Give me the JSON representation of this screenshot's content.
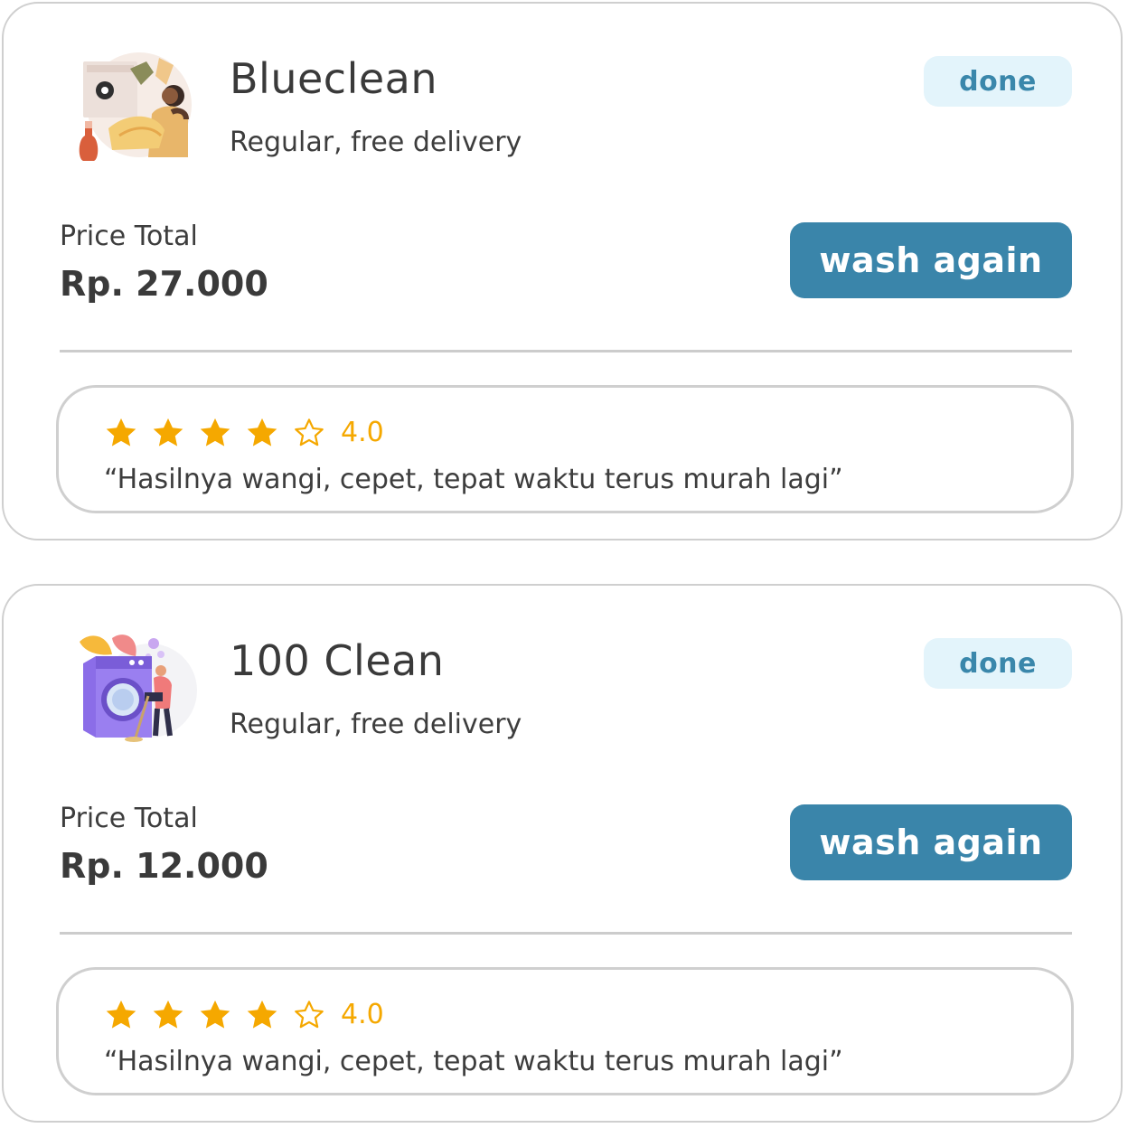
{
  "orders": [
    {
      "shop_name": "Blueclean",
      "service": "Regular, free delivery",
      "status": "done",
      "price_label": "Price Total",
      "price": "Rp. 27.000",
      "action_label": "wash again",
      "rating": 4.0,
      "rating_text": "4.0",
      "review": "“Hasilnya wangi, cepet, tepat waktu terus murah lagi”",
      "image_icon": "person-folding-laundry-illustration"
    },
    {
      "shop_name": "100 Clean",
      "service": "Regular, free delivery",
      "status": "done",
      "price_label": "Price Total",
      "price": "Rp. 12.000",
      "action_label": "wash again",
      "rating": 4.0,
      "rating_text": "4.0",
      "review": "“Hasilnya wangi, cepet, tepat waktu terus murah lagi”",
      "image_icon": "washing-machine-illustration"
    }
  ],
  "colors": {
    "accent": "#3a85aa",
    "status_badge_bg": "#e3f4fb",
    "status_badge_text": "#3a87ab",
    "star": "#f5a800",
    "border": "#cfcfcf",
    "text": "#3d3d3d"
  }
}
